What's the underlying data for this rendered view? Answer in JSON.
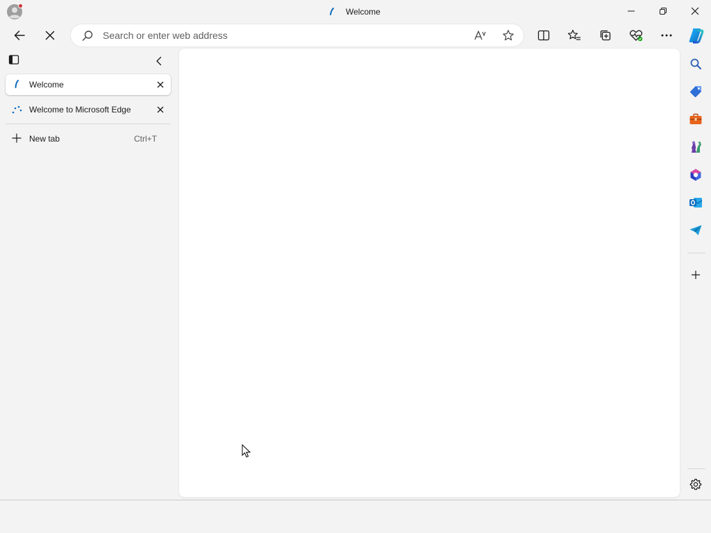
{
  "window": {
    "title": "Welcome",
    "controls": [
      "minimize",
      "restore",
      "close"
    ]
  },
  "toolbar": {
    "back_icon": "back-arrow-icon",
    "stop_icon": "stop-loading-icon",
    "address_placeholder": "Search or enter web address",
    "address_value": "",
    "right_icons": [
      "read-aloud-icon",
      "favorite-star-icon",
      "split-screen-icon",
      "favorites-icon",
      "collections-icon",
      "browser-essentials-icon",
      "more-icon",
      "copilot-icon"
    ]
  },
  "tab_pane": {
    "tabs": [
      {
        "label": "Welcome",
        "active": true,
        "favicon": "edge-loading-favicon"
      },
      {
        "label": "Welcome to Microsoft Edge",
        "active": false,
        "favicon": "edge-loading-dots-favicon"
      }
    ],
    "new_tab": {
      "label": "New tab",
      "shortcut": "Ctrl+T"
    }
  },
  "sidebar": {
    "items": [
      "search-icon",
      "shopping-tag-icon",
      "tools-icon",
      "games-icon",
      "microsoft-365-icon",
      "outlook-icon",
      "telegram-send-icon",
      "add-icon",
      "settings-icon"
    ]
  },
  "colors": {
    "chrome_bg": "#f3f3f3",
    "content_bg": "#ffffff",
    "accent_blue": "#0f6cbd",
    "profile_badge": "#d13438"
  }
}
